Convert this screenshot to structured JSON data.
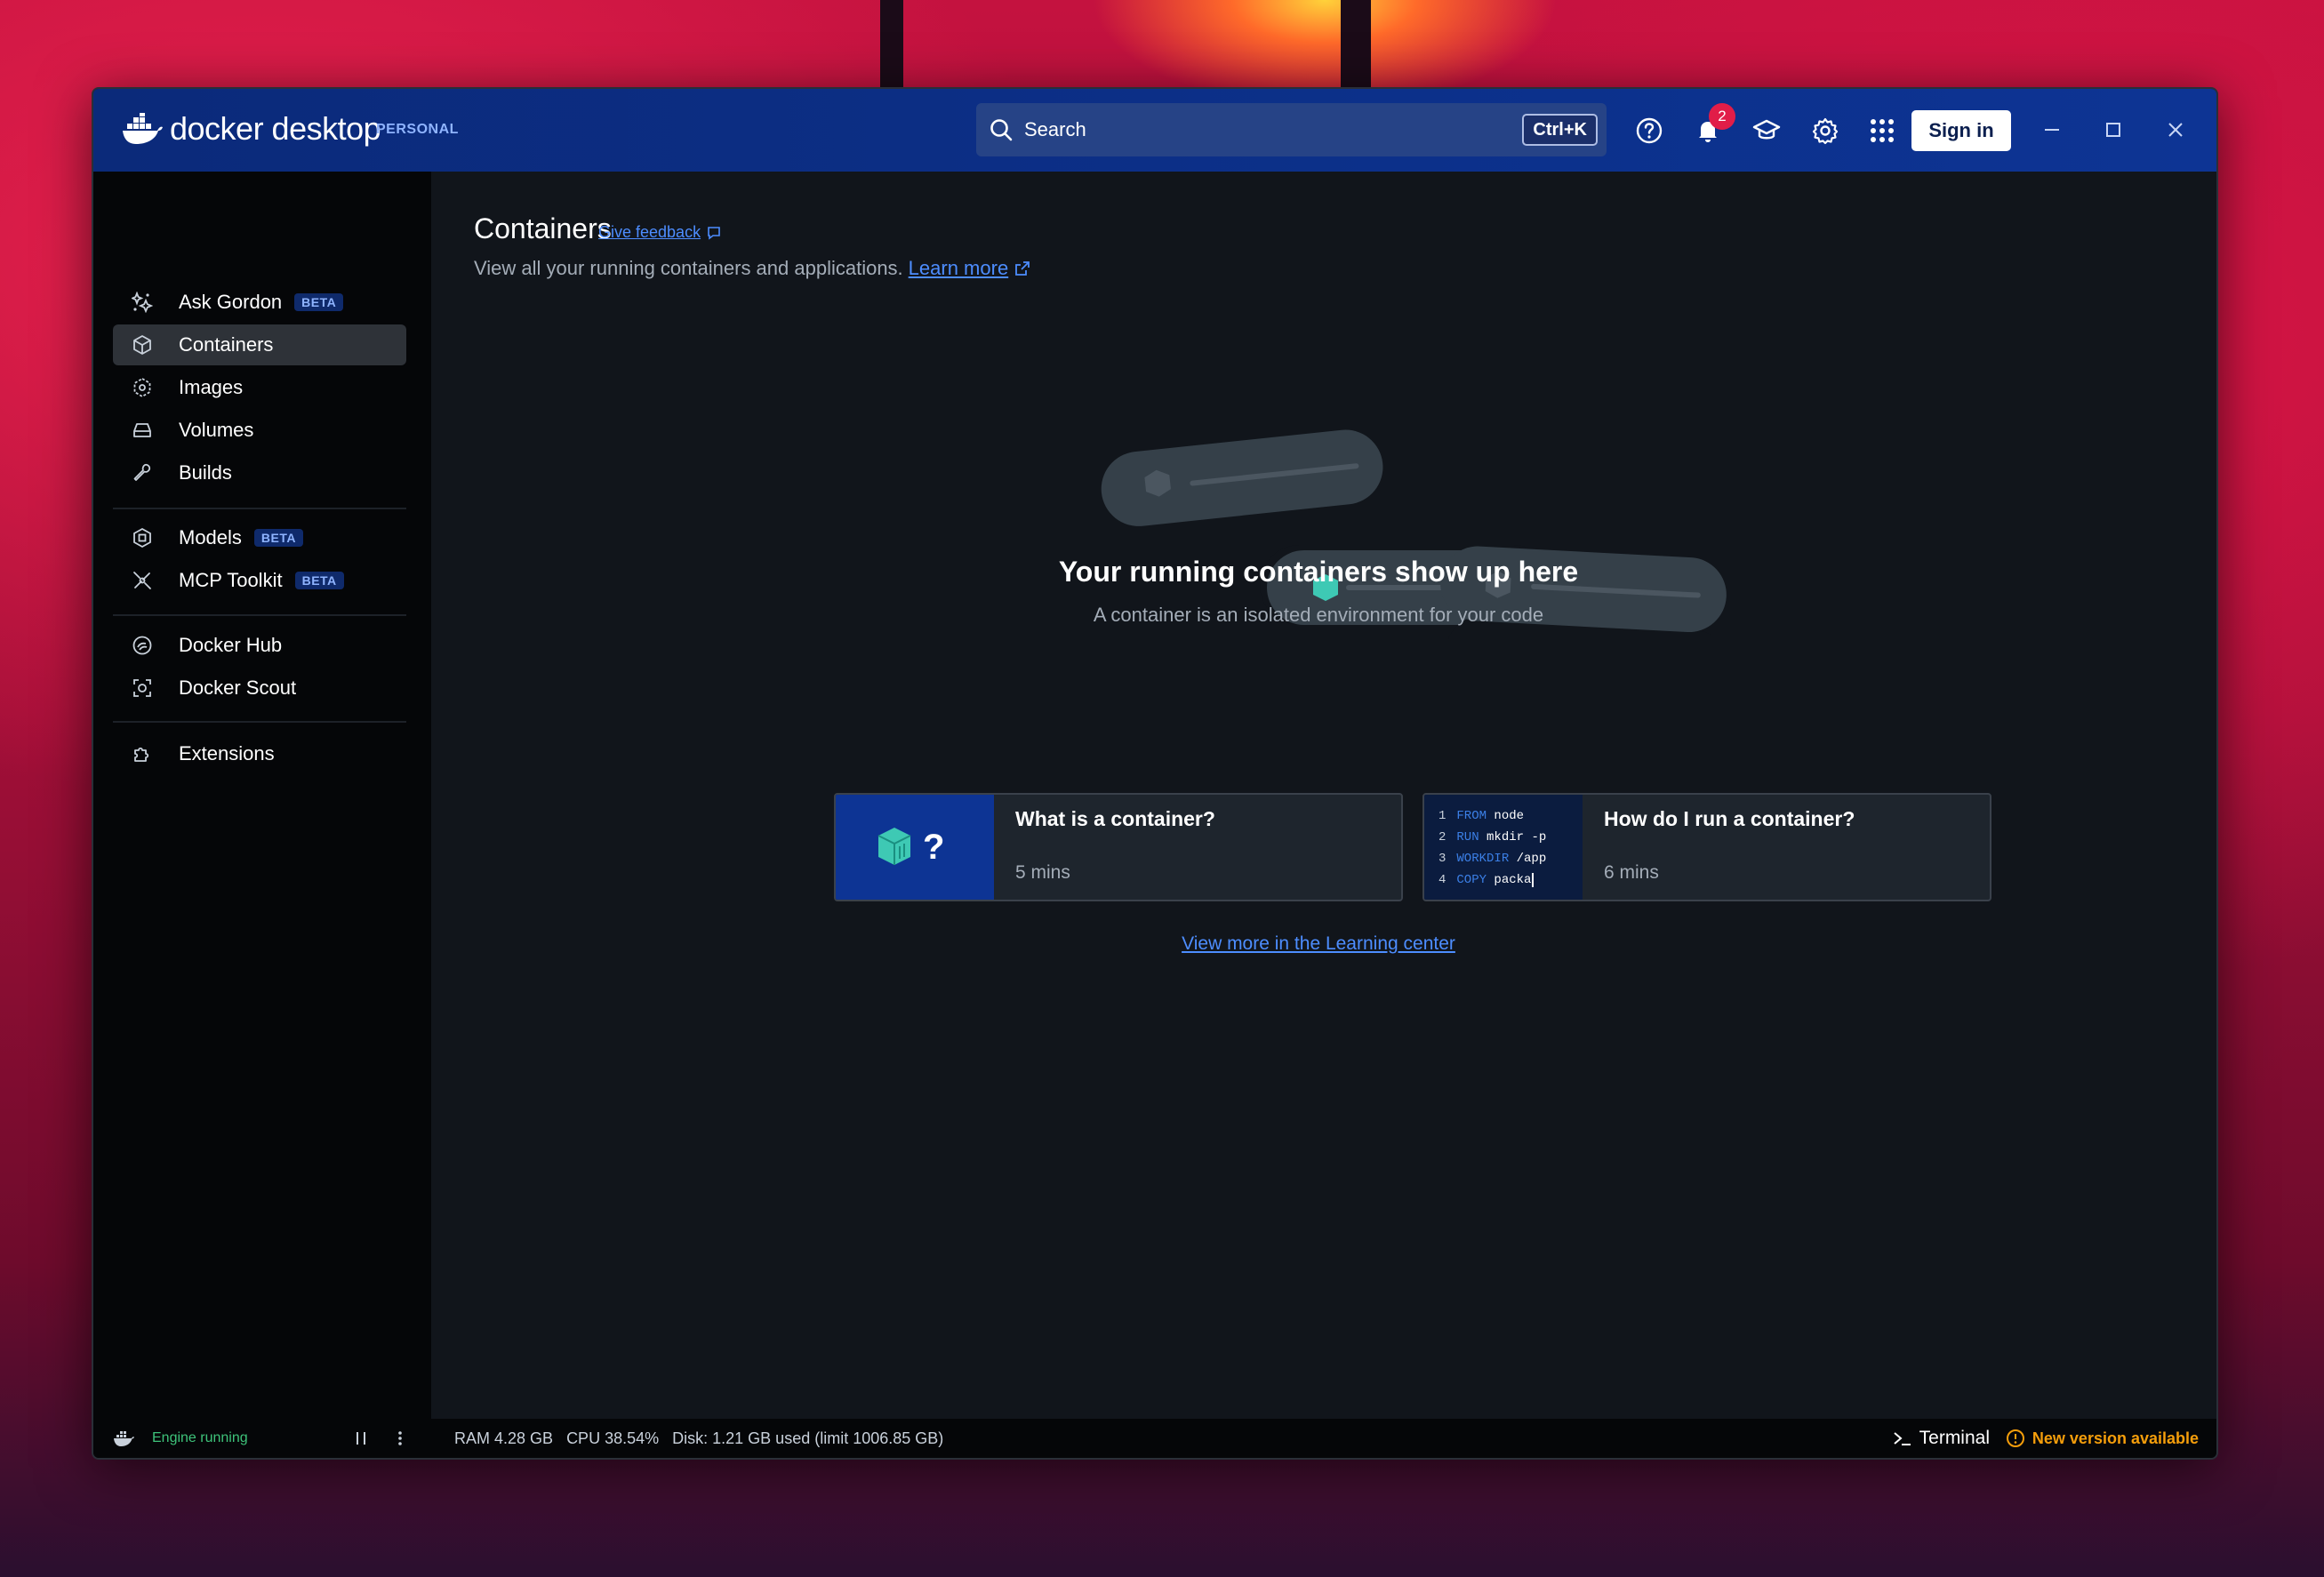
{
  "titlebar": {
    "app_name": "docker desktop",
    "plan": "PERSONAL",
    "search_placeholder": "Search",
    "search_shortcut": "Ctrl+K",
    "notification_count": "2",
    "sign_in_label": "Sign in"
  },
  "sidebar": {
    "items": [
      {
        "label": "Ask Gordon",
        "badge": "BETA",
        "icon": "sparkle-icon"
      },
      {
        "label": "Containers",
        "icon": "container-icon",
        "active": true
      },
      {
        "label": "Images",
        "icon": "image-icon"
      },
      {
        "label": "Volumes",
        "icon": "volume-icon"
      },
      {
        "label": "Builds",
        "icon": "wrench-icon"
      },
      {
        "label": "Models",
        "badge": "BETA",
        "icon": "model-icon"
      },
      {
        "label": "MCP Toolkit",
        "badge": "BETA",
        "icon": "toolkit-icon"
      },
      {
        "label": "Docker Hub",
        "icon": "hub-icon"
      },
      {
        "label": "Docker Scout",
        "icon": "scout-icon"
      },
      {
        "label": "Extensions",
        "icon": "puzzle-icon"
      }
    ]
  },
  "main": {
    "title": "Containers",
    "feedback_link": "Give feedback",
    "subtitle": "View all your running containers and applications.",
    "learn_more": "Learn more",
    "empty_title": "Your running containers show up here",
    "empty_subtitle": "A container is an isolated environment for your code",
    "cards": [
      {
        "title": "What is a container?",
        "duration": "5 mins"
      },
      {
        "title": "How do I run a container?",
        "duration": "6 mins",
        "code": [
          {
            "n": "1",
            "kw": "FROM",
            "rest": "node"
          },
          {
            "n": "2",
            "kw": "RUN",
            "rest": "mkdir -p"
          },
          {
            "n": "3",
            "kw": "WORKDIR",
            "rest": "/app"
          },
          {
            "n": "4",
            "kw": "COPY",
            "rest": "packa"
          }
        ]
      }
    ],
    "view_more": "View more in the Learning center"
  },
  "statusbar": {
    "engine_status": "Engine running",
    "ram": "RAM 4.28 GB",
    "cpu": "CPU 38.54%",
    "disk": "Disk: 1.21 GB used (limit 1006.85 GB)",
    "terminal_label": "Terminal",
    "update_label": "New version available"
  },
  "colors": {
    "titlebar": "#0b2a7a",
    "accent_link": "#4d8dff",
    "engine_green": "#3ec37a",
    "warning": "#f59e0b"
  }
}
